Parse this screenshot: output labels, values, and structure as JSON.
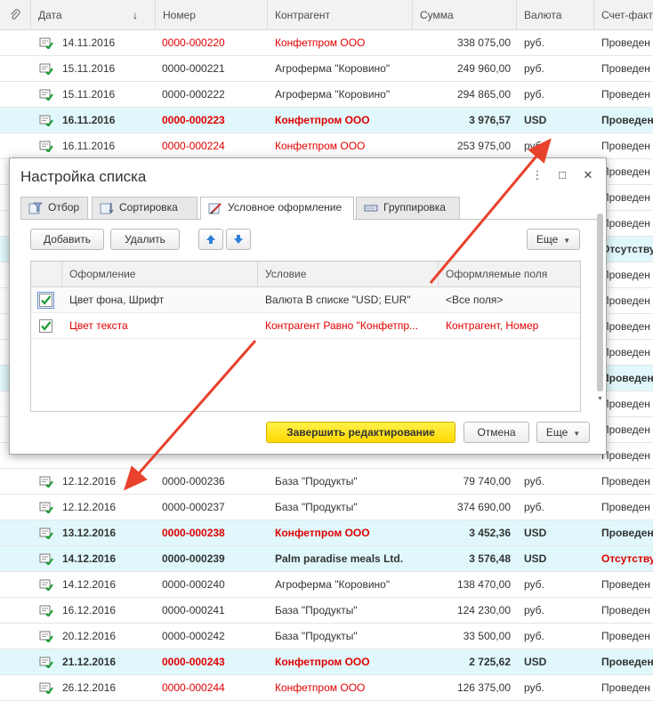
{
  "list": {
    "columns": [
      "Дата",
      "Номер",
      "Контрагент",
      "Сумма",
      "Валюта",
      "Счет-факт"
    ],
    "sort_indicator": "↓",
    "rows": [
      {
        "date": "14.11.2016",
        "number": "0000-000220",
        "contractor": "Конфетпром ООО",
        "sum": "338 075,00",
        "currency": "руб.",
        "status": "Проведен",
        "style": "normal",
        "red": true
      },
      {
        "date": "15.11.2016",
        "number": "0000-000221",
        "contractor": "Агроферма \"Коровино\"",
        "sum": "249 960,00",
        "currency": "руб.",
        "status": "Проведен",
        "style": "normal",
        "red": false
      },
      {
        "date": "15.11.2016",
        "number": "0000-000222",
        "contractor": "Агроферма \"Коровино\"",
        "sum": "294 865,00",
        "currency": "руб.",
        "status": "Проведен",
        "style": "normal",
        "red": false
      },
      {
        "date": "16.11.2016",
        "number": "0000-000223",
        "contractor": "Конфетпром ООО",
        "sum": "3 976,57",
        "currency": "USD",
        "status": "Проведен",
        "style": "hl",
        "red": true
      },
      {
        "date": "16.11.2016",
        "number": "0000-000224",
        "contractor": "Конфетпром ООО",
        "sum": "253 975,00",
        "currency": "руб.",
        "status": "Проведен",
        "style": "normal",
        "red": true
      },
      {
        "date": "",
        "number": "",
        "contractor": "",
        "sum": "",
        "currency": "",
        "status": "Проведен",
        "style": "normal",
        "red": false
      },
      {
        "date": "",
        "number": "",
        "contractor": "",
        "sum": "",
        "currency": "",
        "status": "Проведен",
        "style": "normal",
        "red": false
      },
      {
        "date": "",
        "number": "",
        "contractor": "",
        "sum": "",
        "currency": "",
        "status": "Проведен",
        "style": "normal",
        "red": false
      },
      {
        "date": "",
        "number": "",
        "contractor": "",
        "sum": "",
        "currency": "",
        "status": "Отсутству",
        "style": "hl",
        "red": true
      },
      {
        "date": "",
        "number": "",
        "contractor": "",
        "sum": "",
        "currency": "",
        "status": "Проведен",
        "style": "normal",
        "red": false
      },
      {
        "date": "",
        "number": "",
        "contractor": "",
        "sum": "",
        "currency": "",
        "status": "Проведен",
        "style": "normal",
        "red": false
      },
      {
        "date": "",
        "number": "",
        "contractor": "",
        "sum": "",
        "currency": "",
        "status": "Проведен",
        "style": "normal",
        "red": false
      },
      {
        "date": "",
        "number": "",
        "contractor": "",
        "sum": "",
        "currency": "",
        "status": "Проведен",
        "style": "normal",
        "red": false
      },
      {
        "date": "",
        "number": "",
        "contractor": "",
        "sum": "",
        "currency": "",
        "status": "Проведен",
        "style": "hl",
        "red": false
      },
      {
        "date": "",
        "number": "",
        "contractor": "",
        "sum": "",
        "currency": "",
        "status": "Проведен",
        "style": "normal",
        "red": false
      },
      {
        "date": "",
        "number": "",
        "contractor": "",
        "sum": "",
        "currency": "",
        "status": "Проведен",
        "style": "normal",
        "red": false
      },
      {
        "date": "",
        "number": "",
        "contractor": "",
        "sum": "",
        "currency": "",
        "status": "Проведен",
        "style": "normal",
        "red": false
      },
      {
        "date": "12.12.2016",
        "number": "0000-000236",
        "contractor": "База \"Продукты\"",
        "sum": "79 740,00",
        "currency": "руб.",
        "status": "Проведен",
        "style": "normal",
        "red": false
      },
      {
        "date": "12.12.2016",
        "number": "0000-000237",
        "contractor": "База \"Продукты\"",
        "sum": "374 690,00",
        "currency": "руб.",
        "status": "Проведен",
        "style": "normal",
        "red": false
      },
      {
        "date": "13.12.2016",
        "number": "0000-000238",
        "contractor": "Конфетпром ООО",
        "sum": "3 452,36",
        "currency": "USD",
        "status": "Проведен",
        "style": "hl",
        "red": true
      },
      {
        "date": "14.12.2016",
        "number": "0000-000239",
        "contractor": "Palm paradise meals Ltd.",
        "sum": "3 576,48",
        "currency": "USD",
        "status": "Отсутству",
        "style": "hl",
        "red": false,
        "status_red": true
      },
      {
        "date": "14.12.2016",
        "number": "0000-000240",
        "contractor": "Агроферма \"Коровино\"",
        "sum": "138 470,00",
        "currency": "руб.",
        "status": "Проведен",
        "style": "normal",
        "red": false
      },
      {
        "date": "16.12.2016",
        "number": "0000-000241",
        "contractor": "База \"Продукты\"",
        "sum": "124 230,00",
        "currency": "руб.",
        "status": "Проведен",
        "style": "normal",
        "red": false
      },
      {
        "date": "20.12.2016",
        "number": "0000-000242",
        "contractor": "База \"Продукты\"",
        "sum": "33 500,00",
        "currency": "руб.",
        "status": "Проведен",
        "style": "normal",
        "red": false
      },
      {
        "date": "21.12.2016",
        "number": "0000-000243",
        "contractor": "Конфетпром ООО",
        "sum": "2 725,62",
        "currency": "USD",
        "status": "Проведен",
        "style": "hl",
        "red": true
      },
      {
        "date": "26.12.2016",
        "number": "0000-000244",
        "contractor": "Конфетпром ООО",
        "sum": "126 375,00",
        "currency": "руб.",
        "status": "Проведен",
        "style": "normal",
        "red": true
      }
    ]
  },
  "dialog": {
    "title": "Настройка списка",
    "more_icon": "⋮",
    "maximize_icon": "□",
    "close_icon": "✕",
    "tabs": [
      {
        "label": "Отбор",
        "icon": "filter-icon"
      },
      {
        "label": "Сортировка",
        "icon": "sort-icon"
      },
      {
        "label": "Условное оформление",
        "icon": "brush-icon"
      },
      {
        "label": "Группировка",
        "icon": "group-icon"
      }
    ],
    "toolbar": {
      "add_label": "Добавить",
      "delete_label": "Удалить",
      "more_label": "Еще"
    },
    "grid": {
      "columns": [
        "Оформление",
        "Условие",
        "Оформляемые поля"
      ],
      "rows": [
        {
          "checked": true,
          "appearance": "Цвет фона, Шрифт",
          "condition": "Валюта В списке \"USD; EUR\"",
          "fields": "<Все поля>",
          "red": false
        },
        {
          "checked": true,
          "appearance": "Цвет текста",
          "condition": "Контрагент Равно \"Конфетпр...",
          "fields": "Контрагент, Номер",
          "red": true
        }
      ]
    },
    "footer": {
      "finish_label": "Завершить редактирование",
      "cancel_label": "Отмена",
      "more_label": "Еще"
    }
  },
  "colors": {
    "highlight_row": "#e0f8fb",
    "red_text": "#e00000",
    "primary_button": "#ffe000",
    "arrow": "#e8412c"
  }
}
